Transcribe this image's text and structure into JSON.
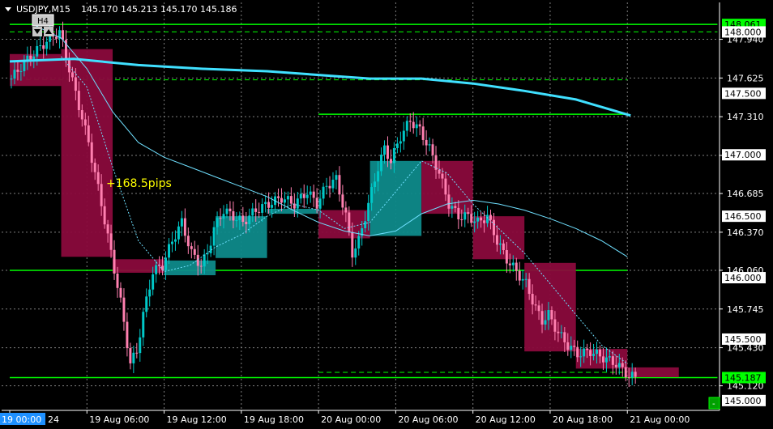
{
  "header": {
    "symbol": "USDJPY,M15",
    "ohlc": "145.170 145.213 145.170 145.186"
  },
  "overlay": {
    "timeframe_label": "H4",
    "annotation": "+168.5pips",
    "corner_button": "-"
  },
  "colors": {
    "background": "#000000",
    "grid": "#7f7f7f",
    "bull": "#0e8a8a",
    "bear": "#8a0a3c",
    "candle_up": "#00c8c8",
    "candle_down": "#ff80b0",
    "ma_fast": "#6fe0ff",
    "ma_slow": "#40e0ff",
    "level": "#00ff00",
    "annotation": "#ffff00"
  },
  "chart_data": {
    "type": "candlestick",
    "symbol": "USDJPY",
    "timeframe": "M15",
    "ylim": [
      144.92,
      148.24
    ],
    "y_ticks": [
      147.94,
      147.625,
      147.31,
      146.995,
      146.685,
      146.37,
      146.06,
      145.745,
      145.43,
      145.12
    ],
    "x_ticks": [
      {
        "label": "19 Aug 2024",
        "idx": 0
      },
      {
        "label": "19 Aug 06:00",
        "idx": 24
      },
      {
        "label": "19 Aug 12:00",
        "idx": 48
      },
      {
        "label": "19 Aug 18:00",
        "idx": 72
      },
      {
        "label": "20 Aug 00:00",
        "idx": 96
      },
      {
        "label": "20 Aug 06:00",
        "idx": 120
      },
      {
        "label": "20 Aug 12:00",
        "idx": 144
      },
      {
        "label": "20 Aug 18:00",
        "idx": 168
      },
      {
        "label": "21 Aug 00:00",
        "idx": 192
      }
    ],
    "x_axis_first_label_box": "19 00:00",
    "price_boxes": [
      {
        "label": "148.061",
        "value": 148.061,
        "bg": "#00ff00",
        "fg": "#000000"
      },
      {
        "label": "148.000",
        "value": 148.0,
        "bg": "#ffffff",
        "fg": "#000000"
      },
      {
        "label": "147.500",
        "value": 147.5,
        "bg": "#ffffff",
        "fg": "#000000"
      },
      {
        "label": "147.000",
        "value": 147.0,
        "bg": "#ffffff",
        "fg": "#000000"
      },
      {
        "label": "146.500",
        "value": 146.5,
        "bg": "#ffffff",
        "fg": "#000000"
      },
      {
        "label": "146.000",
        "value": 146.0,
        "bg": "#ffffff",
        "fg": "#000000"
      },
      {
        "label": "145.500",
        "value": 145.5,
        "bg": "#ffffff",
        "fg": "#000000"
      },
      {
        "label": "145.187",
        "value": 145.187,
        "bg": "#00ff00",
        "fg": "#000000"
      },
      {
        "label": "145.000",
        "value": 145.0,
        "bg": "#ffffff",
        "fg": "#000000"
      }
    ],
    "level_lines": [
      {
        "value": 148.061,
        "style": "solid",
        "from_idx": 0,
        "to_idx": 220
      },
      {
        "value": 148.0,
        "style": "dashed",
        "from_idx": 0,
        "to_idx": 220
      },
      {
        "value": 147.61,
        "style": "dashed",
        "from_idx": 0,
        "to_idx": 192
      },
      {
        "value": 147.33,
        "style": "solid",
        "from_idx": 96,
        "to_idx": 192
      },
      {
        "value": 146.06,
        "style": "solid",
        "from_idx": 0,
        "to_idx": 192
      },
      {
        "value": 145.23,
        "style": "dashed",
        "from_idx": 96,
        "to_idx": 192
      },
      {
        "value": 145.187,
        "style": "solid",
        "from_idx": 0,
        "to_idx": 220
      }
    ],
    "h4_boxes": [
      {
        "start": 0,
        "end": 15,
        "open": 147.82,
        "close": 147.56
      },
      {
        "start": 16,
        "end": 31,
        "open": 147.86,
        "close": 146.17
      },
      {
        "start": 32,
        "end": 47,
        "open": 146.15,
        "close": 146.04
      },
      {
        "start": 48,
        "end": 63,
        "open": 146.02,
        "close": 146.14
      },
      {
        "start": 64,
        "end": 79,
        "open": 146.16,
        "close": 146.5
      },
      {
        "start": 80,
        "end": 95,
        "open": 146.52,
        "close": 146.56
      },
      {
        "start": 96,
        "end": 111,
        "open": 146.55,
        "close": 146.32
      },
      {
        "start": 112,
        "end": 127,
        "open": 146.34,
        "close": 146.95
      },
      {
        "start": 128,
        "end": 143,
        "open": 146.95,
        "close": 146.52
      },
      {
        "start": 144,
        "end": 159,
        "open": 146.5,
        "close": 146.15
      },
      {
        "start": 160,
        "end": 175,
        "open": 146.12,
        "close": 145.4
      },
      {
        "start": 176,
        "end": 191,
        "open": 145.42,
        "close": 145.26
      },
      {
        "start": 192,
        "end": 207,
        "open": 145.27,
        "close": 145.19
      }
    ],
    "close_path": [
      [
        0,
        147.62
      ],
      [
        4,
        147.75
      ],
      [
        8,
        147.85
      ],
      [
        12,
        147.95
      ],
      [
        15,
        148.0
      ],
      [
        17,
        147.8
      ],
      [
        20,
        147.5
      ],
      [
        24,
        147.1
      ],
      [
        28,
        146.6
      ],
      [
        31,
        146.2
      ],
      [
        34,
        145.8
      ],
      [
        37,
        145.3
      ],
      [
        39,
        145.4
      ],
      [
        41,
        145.7
      ],
      [
        44,
        146.05
      ],
      [
        47,
        146.1
      ],
      [
        50,
        146.3
      ],
      [
        53,
        146.45
      ],
      [
        56,
        146.2
      ],
      [
        59,
        146.1
      ],
      [
        61,
        146.2
      ],
      [
        63,
        146.4
      ],
      [
        66,
        146.55
      ],
      [
        69,
        146.5
      ],
      [
        72,
        146.45
      ],
      [
        76,
        146.55
      ],
      [
        80,
        146.6
      ],
      [
        84,
        146.65
      ],
      [
        88,
        146.6
      ],
      [
        92,
        146.7
      ],
      [
        95,
        146.6
      ],
      [
        98,
        146.75
      ],
      [
        101,
        146.8
      ],
      [
        104,
        146.5
      ],
      [
        106,
        146.2
      ],
      [
        108,
        146.3
      ],
      [
        111,
        146.6
      ],
      [
        114,
        146.9
      ],
      [
        116,
        147.05
      ],
      [
        118,
        146.95
      ],
      [
        121,
        147.15
      ],
      [
        124,
        147.28
      ],
      [
        127,
        147.2
      ],
      [
        130,
        147.05
      ],
      [
        133,
        146.85
      ],
      [
        136,
        146.6
      ],
      [
        139,
        146.5
      ],
      [
        142,
        146.5
      ],
      [
        145,
        146.45
      ],
      [
        148,
        146.5
      ],
      [
        151,
        146.3
      ],
      [
        154,
        146.15
      ],
      [
        157,
        146.05
      ],
      [
        160,
        145.95
      ],
      [
        163,
        145.75
      ],
      [
        165,
        145.65
      ],
      [
        167,
        145.7
      ],
      [
        170,
        145.55
      ],
      [
        173,
        145.45
      ],
      [
        176,
        145.38
      ],
      [
        180,
        145.4
      ],
      [
        184,
        145.35
      ],
      [
        188,
        145.3
      ],
      [
        190,
        145.25
      ],
      [
        192,
        145.2
      ],
      [
        194,
        145.19
      ]
    ],
    "ma_slow": [
      [
        0,
        147.76
      ],
      [
        20,
        147.78
      ],
      [
        40,
        147.73
      ],
      [
        60,
        147.7
      ],
      [
        80,
        147.68
      ],
      [
        96,
        147.65
      ],
      [
        112,
        147.62
      ],
      [
        128,
        147.62
      ],
      [
        144,
        147.58
      ],
      [
        160,
        147.52
      ],
      [
        176,
        147.45
      ],
      [
        193,
        147.32
      ]
    ],
    "ma_fast": [
      [
        8,
        148.05
      ],
      [
        16,
        147.95
      ],
      [
        24,
        147.7
      ],
      [
        32,
        147.35
      ],
      [
        40,
        147.1
      ],
      [
        48,
        146.98
      ],
      [
        56,
        146.9
      ],
      [
        64,
        146.82
      ],
      [
        72,
        146.74
      ],
      [
        80,
        146.66
      ],
      [
        88,
        146.55
      ],
      [
        96,
        146.45
      ],
      [
        104,
        146.38
      ],
      [
        112,
        146.34
      ],
      [
        120,
        146.38
      ],
      [
        128,
        146.52
      ],
      [
        136,
        146.6
      ],
      [
        144,
        146.63
      ],
      [
        152,
        146.6
      ],
      [
        160,
        146.55
      ],
      [
        168,
        146.48
      ],
      [
        176,
        146.4
      ],
      [
        184,
        146.3
      ],
      [
        192,
        146.17
      ]
    ],
    "ma_dotted": [
      [
        16,
        147.8
      ],
      [
        24,
        147.55
      ],
      [
        32,
        146.9
      ],
      [
        40,
        146.3
      ],
      [
        48,
        146.05
      ],
      [
        56,
        146.1
      ],
      [
        64,
        146.25
      ],
      [
        72,
        146.35
      ],
      [
        80,
        146.5
      ],
      [
        88,
        146.6
      ],
      [
        96,
        146.55
      ],
      [
        104,
        146.4
      ],
      [
        112,
        146.45
      ],
      [
        120,
        146.7
      ],
      [
        128,
        146.95
      ],
      [
        136,
        146.85
      ],
      [
        144,
        146.6
      ],
      [
        152,
        146.4
      ],
      [
        160,
        146.2
      ],
      [
        168,
        145.95
      ],
      [
        176,
        145.7
      ],
      [
        184,
        145.45
      ],
      [
        192,
        145.3
      ]
    ]
  }
}
